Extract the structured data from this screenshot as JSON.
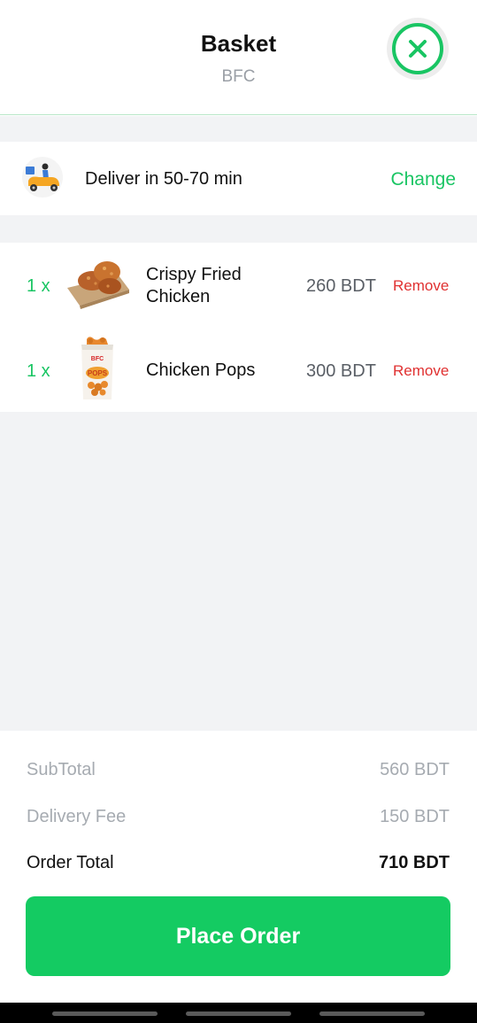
{
  "header": {
    "title": "Basket",
    "subtitle": "BFC",
    "close_icon": "close-x-icon"
  },
  "delivery": {
    "text": "Deliver in 50-70 min",
    "change_label": "Change",
    "icon": "scooter-icon"
  },
  "items": [
    {
      "qty": "1 x",
      "name": "Crispy Fried Chicken",
      "name_line1": "Crispy Fried",
      "name_line2": "Chicken",
      "price": "260 BDT",
      "remove_label": "Remove"
    },
    {
      "qty": "1 x",
      "name": "Chicken Pops",
      "price": "300 BDT",
      "remove_label": "Remove"
    }
  ],
  "summary": {
    "subtotal_label": "SubTotal",
    "subtotal_value": "560 BDT",
    "delivery_fee_label": "Delivery Fee",
    "delivery_fee_value": "150 BDT",
    "order_total_label": "Order Total",
    "order_total_value": "710 BDT"
  },
  "place_order_label": "Place Order",
  "package_brand": "BFC",
  "package_text": "POPS",
  "colors": {
    "accent": "#19c563",
    "button": "#14cb62",
    "remove": "#e03131"
  }
}
